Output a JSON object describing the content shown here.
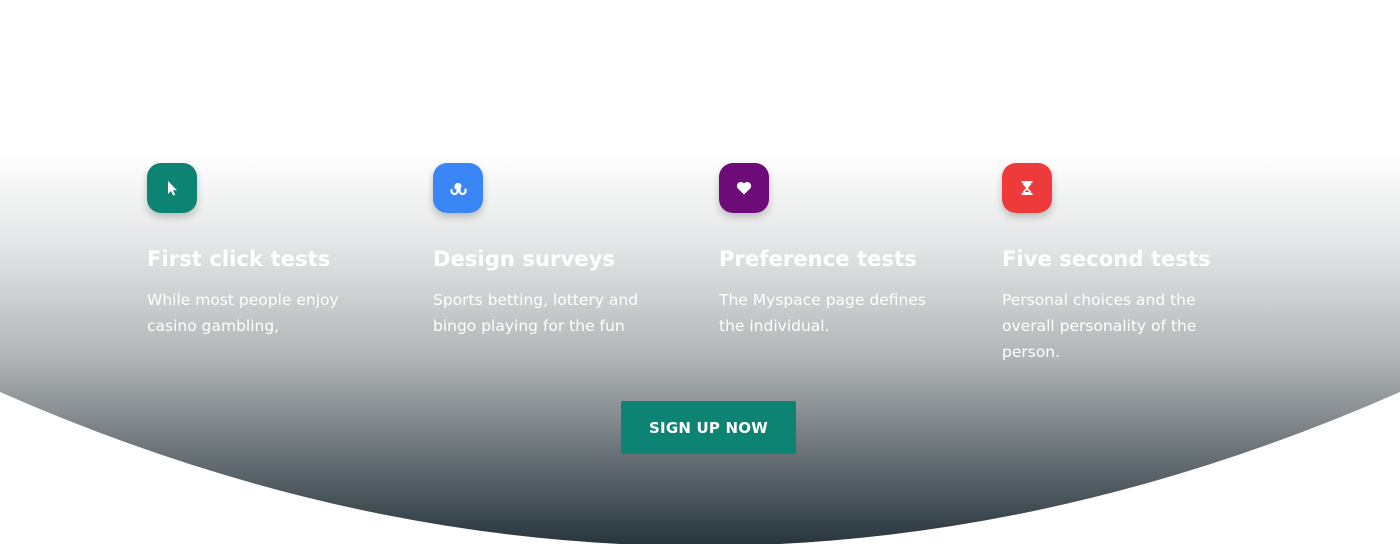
{
  "features": [
    {
      "title": "First click tests",
      "description": "While most people enjoy casino gambling,",
      "icon": "cursor-icon",
      "color": "#0d8473"
    },
    {
      "title": "Design surveys",
      "description": "Sports betting, lottery and bingo playing for the fun",
      "icon": "stumbleupon-icon",
      "color": "#3b86f6"
    },
    {
      "title": "Preference tests",
      "description": "The Myspace page defines the individual.",
      "icon": "heart-icon",
      "color": "#6d0b78"
    },
    {
      "title": "Five second tests",
      "description": "Personal choices and the overall personality of the person.",
      "icon": "hourglass-icon",
      "color": "#ee3a3a"
    }
  ],
  "cta": {
    "label": "SIGN UP NOW",
    "color": "#0d8473"
  },
  "colors": {
    "gradient_top": "#ffffff",
    "gradient_bottom": "#26343c"
  }
}
